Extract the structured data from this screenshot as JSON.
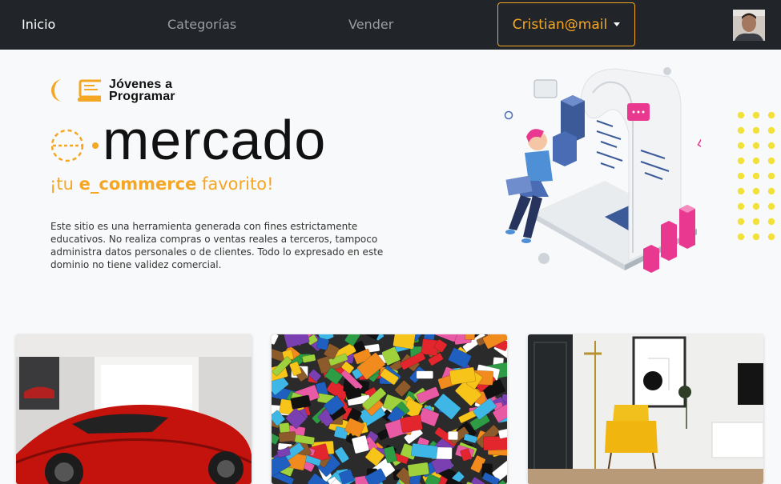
{
  "nav": {
    "items": [
      {
        "label": "Inicio"
      },
      {
        "label": "Categorías"
      },
      {
        "label": "Vender"
      }
    ],
    "user": {
      "label": "Cristian@mail"
    }
  },
  "hero": {
    "logo": {
      "line1": "Jóvenes a",
      "line2": "Programar"
    },
    "brand": {
      "prefix": "e",
      "word": "mercado"
    },
    "tagline": {
      "pre": "¡tu ",
      "bold": "e_commerce",
      "post": " favorito!"
    },
    "disclaimer": "Este sitio es una herramienta generada con fines estrictamente educativos. No realiza compras o ventas reales a terceros, tampoco administra datos personales o de clientes. Todo lo expresado en este dominio no tiene validez comercial."
  },
  "colors": {
    "accent": "#f5a623",
    "navbar": "#212529",
    "pink": "#e8388f",
    "blue": "#3d5a98",
    "yellow_dots": "#f2e13a"
  },
  "cards": [
    {
      "icon": "red-sports-car-photo"
    },
    {
      "icon": "toy-bricks-photo"
    },
    {
      "icon": "living-room-armchair-photo"
    }
  ]
}
